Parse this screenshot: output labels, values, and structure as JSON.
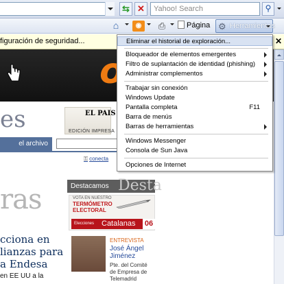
{
  "address_bar": {
    "value": ""
  },
  "search": {
    "placeholder": "Yahoo! Search"
  },
  "command_bar": {
    "page_label": "Página",
    "tools_label": "Herramientas"
  },
  "info_bar": {
    "text": "figuración de seguridad..."
  },
  "tools_menu": {
    "items": [
      {
        "label": "Eliminar el historial de exploración...",
        "highlighted": true
      },
      {
        "label": "Bloqueador de elementos emergentes",
        "submenu": true
      },
      {
        "label": "Filtro de suplantación de identidad (phishing)",
        "submenu": true
      },
      {
        "label": "Administrar complementos",
        "submenu": true
      },
      {
        "label": "Trabajar sin conexión"
      },
      {
        "label": "Windows Update"
      },
      {
        "label": "Pantalla completa",
        "shortcut": "F11"
      },
      {
        "label": "Barra de menús"
      },
      {
        "label": "Barras de herramientas",
        "submenu": true
      },
      {
        "label": "Windows Messenger"
      },
      {
        "label": "Consola de Sun Java"
      },
      {
        "label": "Opciones de Internet"
      }
    ]
  },
  "page": {
    "logo_fragment": "es",
    "elpais": "EL PAIS",
    "edicion": "EDICIÓN IMPRESA",
    "archive_tab": "el archivo",
    "conecta": "conecta",
    "big_gray": "ras",
    "headline": "cciona en lianzas para a Endesa",
    "snippet": "en EE UU a la",
    "destacamos": "Destacamos",
    "destacamos_ghost": "Desta",
    "termo_line1": "VOTA EN NUESTRO",
    "termo_line2": "TERMÓMETRO",
    "termo_line3": "ELECTORAL",
    "catalanas_small": "Elecciones",
    "catalanas_big": "Catalanas",
    "catalanas_num": "06",
    "interview_kicker": "ENTREVISTA",
    "interview_name1": "José Ángel",
    "interview_name2": "Jiménez",
    "interview_desc1": "Pte. del Comité",
    "interview_desc2": "de Empresa de",
    "interview_desc3": "Telemadrid"
  },
  "colors": {
    "accent": "#ef7b12",
    "nav_blue": "#54709b",
    "menu_highlight": "#d8e2f2"
  }
}
